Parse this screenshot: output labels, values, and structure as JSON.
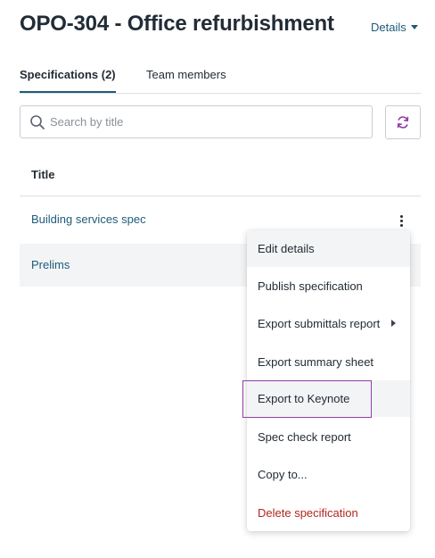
{
  "header": {
    "title": "OPO-304 - Office refurbishment",
    "details_label": "Details"
  },
  "tabs": [
    {
      "label": "Specifications (2)",
      "active": true
    },
    {
      "label": "Team members",
      "active": false
    }
  ],
  "search": {
    "placeholder": "Search by title",
    "value": ""
  },
  "table": {
    "column_header": "Title",
    "rows": [
      {
        "title": "Building services spec"
      },
      {
        "title": "Prelims"
      }
    ]
  },
  "context_menu": {
    "items": [
      {
        "label": "Edit details"
      },
      {
        "label": "Publish specification"
      },
      {
        "label": "Export submittals report",
        "has_submenu": true
      },
      {
        "label": "Export summary sheet"
      },
      {
        "label": "Export to Keynote",
        "focused": true
      },
      {
        "label": "Spec check report"
      },
      {
        "label": "Copy to..."
      },
      {
        "label": "Delete specification",
        "destructive": true
      }
    ]
  },
  "colors": {
    "accent": "#1e5b7a",
    "focus_outline": "#8e3fa8",
    "danger": "#b3261e",
    "refresh_icon": "#8e3fa8"
  },
  "icons": {
    "search": "search-icon",
    "refresh": "refresh-icon",
    "more": "kebab-menu-icon",
    "details_caret": "caret-down-icon",
    "submenu_caret": "caret-right-icon"
  }
}
